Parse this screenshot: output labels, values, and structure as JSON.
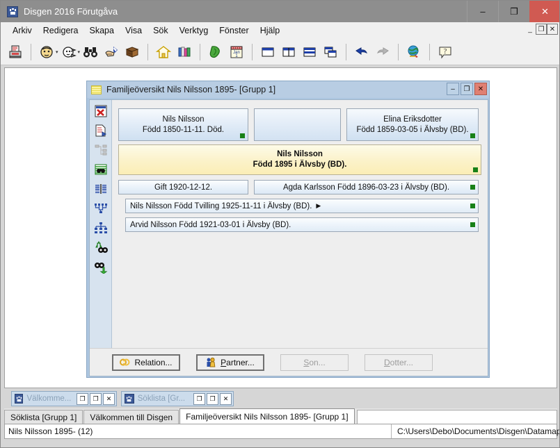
{
  "window": {
    "title": "Disgen 2016 Förutgåva",
    "app_icon": "disgen-logo-icon",
    "controls": {
      "minimize": "–",
      "maximize": "❐",
      "close": "✕"
    }
  },
  "menubar": {
    "items": [
      {
        "label": "Arkiv",
        "name": "menu-arkiv"
      },
      {
        "label": "Redigera",
        "name": "menu-redigera"
      },
      {
        "label": "Skapa",
        "name": "menu-skapa"
      },
      {
        "label": "Visa",
        "name": "menu-visa"
      },
      {
        "label": "Sök",
        "name": "menu-sok"
      },
      {
        "label": "Verktyg",
        "name": "menu-verktyg"
      },
      {
        "label": "Fönster",
        "name": "menu-fonster"
      },
      {
        "label": "Hjälp",
        "name": "menu-hjalp"
      }
    ],
    "mdi_controls": {
      "minimize": "_",
      "restore": "❐",
      "close": "✕"
    }
  },
  "toolbar": {
    "icons": [
      {
        "name": "print-icon",
        "title": "Skriv ut"
      },
      {
        "name": "person-man-icon",
        "title": "Person"
      },
      {
        "name": "person-woman-icon",
        "title": "Person kvinna"
      },
      {
        "name": "binoculars-search-icon",
        "title": "Sök"
      },
      {
        "name": "hand-pointer-icon",
        "title": "Peka"
      },
      {
        "name": "book-icon",
        "title": "Bok"
      },
      {
        "name": "home-icon",
        "title": "Hem"
      },
      {
        "name": "books-shelf-icon",
        "title": "Källor"
      },
      {
        "name": "map-globe-green-icon",
        "title": "Orter"
      },
      {
        "name": "calendar-jan1-icon",
        "title": "Kalender"
      },
      {
        "name": "window-single-icon",
        "title": "Ett fönster"
      },
      {
        "name": "window-vertical-split-icon",
        "title": "Dela lodrätt"
      },
      {
        "name": "window-horizontal-split-icon",
        "title": "Dela vågrätt"
      },
      {
        "name": "window-cascade-icon",
        "title": "Överlappa"
      },
      {
        "name": "undo-arrow-icon",
        "title": "Ångra"
      },
      {
        "name": "redo-arrow-icon",
        "title": "Gör om"
      },
      {
        "name": "globe-world-icon",
        "title": "Karta"
      },
      {
        "name": "help-question-icon",
        "title": "Hjälp"
      }
    ]
  },
  "child_window": {
    "title": "Familjeöversikt Nils Nilsson 1895- [Grupp 1]",
    "icon": "family-overview-icon",
    "controls": {
      "minimize": "–",
      "maximize": "❐",
      "close": "✕"
    },
    "side_icons": [
      {
        "name": "close-red-x-icon",
        "title": "Stäng"
      },
      {
        "name": "document-edit-icon",
        "title": "Redigera person"
      },
      {
        "name": "tree-structure-grey-icon",
        "title": "Struktur"
      },
      {
        "name": "table-search-icon",
        "title": "Sök i tabell"
      },
      {
        "name": "columns-compare-icon",
        "title": "Jämför"
      },
      {
        "name": "descendant-chart-icon",
        "title": "Antavla"
      },
      {
        "name": "org-chart-icon",
        "title": "Stamtavla"
      },
      {
        "name": "search-up-icon",
        "title": "Sök uppåt"
      },
      {
        "name": "search-down-icon",
        "title": "Sök nedåt"
      }
    ],
    "parents": {
      "father": {
        "line1": "Nils Nilsson",
        "line2": "Född 1850-11-11. Död.",
        "has_marker": true
      },
      "middle": {
        "line1": "",
        "line2": "",
        "has_marker": false
      },
      "mother": {
        "line1": "Elina Eriksdotter",
        "line2": "Född 1859-03-05 i Älvsby (BD).",
        "has_marker": true
      }
    },
    "focus_person": {
      "line1": "Nils Nilsson",
      "line2": "Född 1895 i Älvsby (BD).",
      "has_marker": true
    },
    "marriage": {
      "label": "Gift 1920-12-12.",
      "partner": "Agda Karlsson Född 1896-03-23 i Älvsby (BD).",
      "has_marker": true
    },
    "children": [
      {
        "label": "Nils Nilsson Född Tvilling 1925-11-11 i Älvsby (BD).",
        "expander": "▶",
        "has_expander": true,
        "has_marker": true
      },
      {
        "label": "Arvid Nilsson Född 1921-03-01 i Älvsby (BD).",
        "expander": "",
        "has_expander": false,
        "has_marker": true
      }
    ],
    "buttons": [
      {
        "label": "Relation...",
        "icon": "rings-relation-icon",
        "enabled": true,
        "name": "relation-button"
      },
      {
        "label": "Partner...",
        "icon": "partner-couple-icon",
        "enabled": true,
        "name": "partner-button",
        "accesskey": "P"
      },
      {
        "label": "Son...",
        "icon": "",
        "enabled": false,
        "name": "son-button",
        "accesskey": "S"
      },
      {
        "label": "Dotter...",
        "icon": "",
        "enabled": false,
        "name": "dotter-button",
        "accesskey": "D"
      }
    ]
  },
  "minimized_windows": [
    {
      "label": "Välkomme...",
      "icon": "disgen-logo-icon",
      "buttons": {
        "restore": "❐",
        "maximize": "❐",
        "close": "✕"
      }
    },
    {
      "label": "Söklista [Gr...",
      "icon": "disgen-logo-icon",
      "buttons": {
        "restore": "❐",
        "maximize": "❐",
        "close": "✕"
      }
    }
  ],
  "tabs": [
    {
      "label": "Söklista [Grupp 1]",
      "active": false,
      "name": "tab-soklista"
    },
    {
      "label": "Välkommen till Disgen",
      "active": false,
      "name": "tab-valkommen"
    },
    {
      "label": "Familjeöversikt Nils Nilsson 1895- [Grupp 1]",
      "active": true,
      "name": "tab-familjeoversikt"
    }
  ],
  "statusbar": {
    "left": "Nils Nilsson 1895- (12)",
    "right": "C:\\Users\\Debo\\Documents\\Disgen\\Datamapp"
  },
  "colors": {
    "title_bar": "#8e8e8e",
    "close_red": "#d05a52",
    "child_title": "#b8cde3",
    "child_frame": "#adc6e0",
    "focus_yellow": "#fbf2c9",
    "person_blue": "#e3edf8",
    "marker_green": "#178017"
  }
}
